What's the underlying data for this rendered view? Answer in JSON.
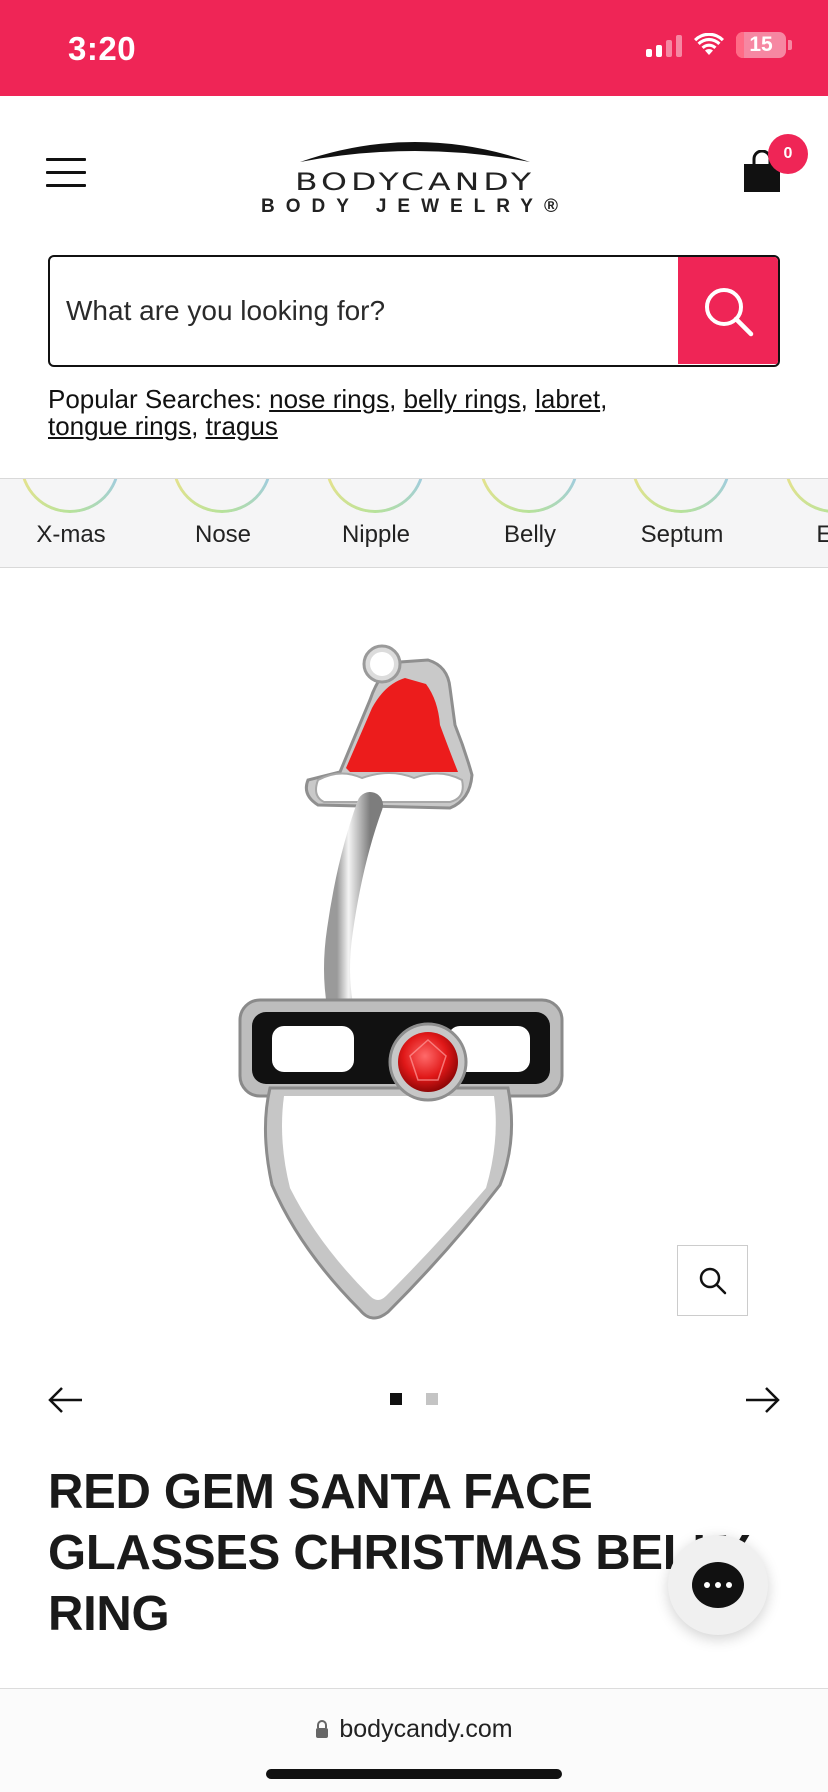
{
  "status_bar": {
    "time": "3:20",
    "battery_level": "15",
    "battery_fraction": 0.15
  },
  "header": {
    "logo_name": "BODYCANDY",
    "logo_sub": "BODY JEWELRY®",
    "cart_count": "0"
  },
  "search": {
    "placeholder": "What are you looking for?"
  },
  "popular": {
    "label": "Popular Searches:",
    "links": [
      "nose rings",
      "belly rings",
      "labret",
      "tongue rings",
      "tragus"
    ],
    "separator": ", ",
    "trailing": ","
  },
  "categories": [
    {
      "label": "X-mas"
    },
    {
      "label": "Nose"
    },
    {
      "label": "Nipple"
    },
    {
      "label": "Belly"
    },
    {
      "label": "Septum"
    },
    {
      "label": "Ear"
    }
  ],
  "carousel": {
    "total_slides": 2,
    "active_slide": 1
  },
  "product": {
    "title": "RED GEM SANTA FACE GLASSES CHRISTMAS BELLY RING"
  },
  "browser": {
    "url": "bodycandy.com"
  },
  "colors": {
    "brand": "#ef2556",
    "text": "#1a1a1a",
    "strip_bg": "#f5f5f6"
  },
  "icons": {
    "menu": "hamburger-menu-icon",
    "cart": "shopping-bag-icon",
    "search": "search-icon",
    "zoom": "zoom-icon",
    "prev": "arrow-left-icon",
    "next": "arrow-right-icon",
    "chat": "chat-icon",
    "lock": "lock-icon"
  }
}
